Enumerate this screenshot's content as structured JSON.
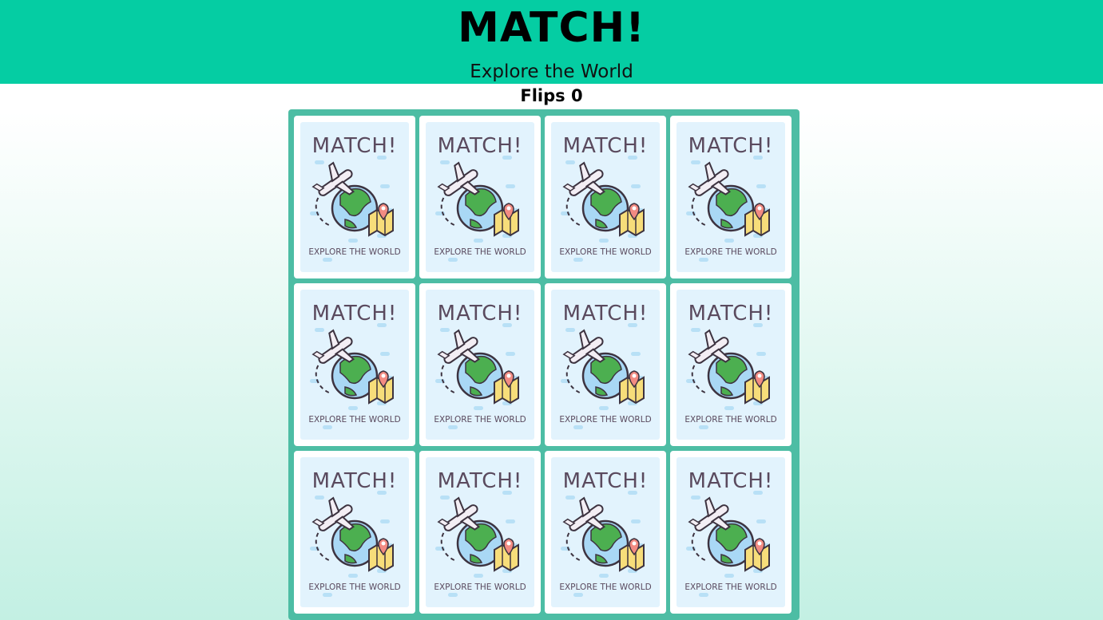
{
  "header": {
    "title": "MATCH!",
    "subtitle": "Explore the World"
  },
  "stats": {
    "flips_label": "Flips",
    "flips_value": "0"
  },
  "colors": {
    "header_bg": "#05cda3",
    "board_bg": "#4dbda4",
    "card_bg": "#ffffff",
    "card_face_bg": "#e2f3fd",
    "card_text": "#5a4a5e",
    "globe_land": "#4caf50",
    "globe_sea": "#a9d8f5"
  },
  "card_back": {
    "title": "MATCH!",
    "caption": "EXPLORE THE WORLD",
    "icons": [
      "airplane-icon",
      "globe-icon",
      "map-icon",
      "location-pin-icon"
    ]
  },
  "cards": [
    {
      "id": 1,
      "state": "face-down"
    },
    {
      "id": 2,
      "state": "face-down"
    },
    {
      "id": 3,
      "state": "face-down"
    },
    {
      "id": 4,
      "state": "face-down"
    },
    {
      "id": 5,
      "state": "face-down"
    },
    {
      "id": 6,
      "state": "face-down"
    },
    {
      "id": 7,
      "state": "face-down"
    },
    {
      "id": 8,
      "state": "face-down"
    },
    {
      "id": 9,
      "state": "face-down"
    },
    {
      "id": 10,
      "state": "face-down"
    },
    {
      "id": 11,
      "state": "face-down"
    },
    {
      "id": 12,
      "state": "face-down"
    }
  ]
}
